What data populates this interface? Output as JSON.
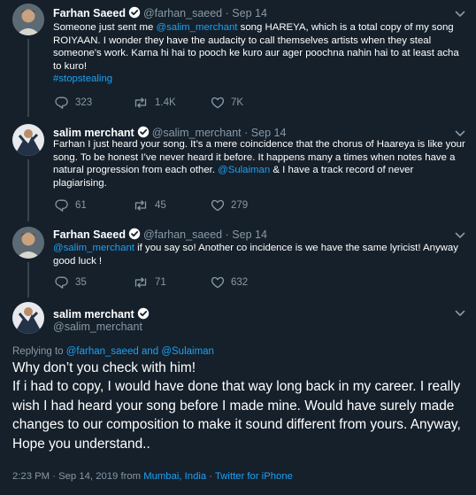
{
  "tweets": [
    {
      "name": "Farhan Saeed",
      "handle": "@farhan_saeed",
      "separator": "·",
      "date": "Sep 14",
      "text_pre": "Someone just sent me ",
      "mention": "@salim_merchant",
      "text_post": " song HAREYA, which is a total copy of my song ROIYAAN. I wonder they have the audacity to call themselves artists when they steal someone's work. Karna hi hai to pooch ke kuro aur ager poochna nahin hai to at least acha to kuro!",
      "hashtag": "#stopstealing",
      "replies": "323",
      "retweets": "1.4K",
      "likes": "7K"
    },
    {
      "name": "salim merchant",
      "handle": "@salim_merchant",
      "separator": "·",
      "date": "Sep 14",
      "text_pre": "Farhan I just heard your song. It’s a mere coincidence that the chorus of Haareya is like your song. To be honest I’ve never heard it before. It happens many a times when notes have a natural progression from each other. ",
      "mention": "@Sulaiman",
      "text_post": " & I have a track record of never plagiarising.",
      "replies": "61",
      "retweets": "45",
      "likes": "279"
    },
    {
      "name": "Farhan Saeed",
      "handle": "@farhan_saeed",
      "separator": "·",
      "date": "Sep 14",
      "mention": "@salim_merchant",
      "text_post": " if you say so! Another co incidence is we have the same lyricist! Anyway good luck !",
      "replies": "35",
      "retweets": "71",
      "likes": "632"
    }
  ],
  "main_tweet": {
    "name": "salim merchant",
    "handle": "@salim_merchant",
    "replying_label": "Replying to ",
    "replying_to": "@farhan_saeed and @Sulaiman",
    "text": "Why don’t you check with him!\nIf i had to copy, I would have done that way long back in my career. I really wish I had heard your song before I made mine. Would have surely made changes to our composition to make it sound different from yours. Anyway, Hope you understand..",
    "time": "2:23 PM · Sep 14, 2019 from ",
    "location": "Mumbai, India",
    "separator": " · ",
    "source": "Twitter for iPhone"
  },
  "icons": {
    "verified": "verified-badge-icon",
    "caret": "chevron-down-icon",
    "reply": "reply-icon",
    "retweet": "retweet-icon",
    "like": "heart-icon"
  },
  "colors": {
    "background": "#15202b",
    "text": "#ffffff",
    "secondary": "#8899a6",
    "accent": "#1da1f2",
    "divider": "#38444d"
  }
}
